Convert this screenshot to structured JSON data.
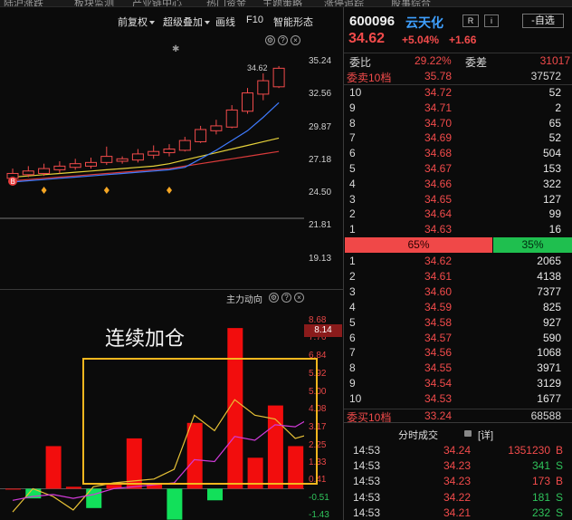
{
  "top_strip": [
    "陆沪涨跌",
    "板块监测",
    "产业链中心",
    "热门资金",
    "主题策略",
    "涨停追踪",
    "股事综合"
  ],
  "toolbar": {
    "fuquan": "前复权",
    "overlay": "超级叠加",
    "draw": "画线",
    "f10": "F10",
    "smart": "智能形态",
    "panel_icons": [
      "⚙",
      "?",
      "×"
    ]
  },
  "stock": {
    "code": "600096",
    "name": "云天化",
    "r_label": "R",
    "i_label": "i",
    "watchlist_btn": "-自选",
    "price": "34.62",
    "pct_change": "+5.04%",
    "change": "+1.66"
  },
  "weibi": {
    "label": "委比",
    "value": "29.22%",
    "diff_label": "委差",
    "diff_value": "31017"
  },
  "sell_header": {
    "label": "委卖10档",
    "avg_price": "35.78",
    "total": "37572"
  },
  "sell_levels": [
    {
      "level": "10",
      "price": "34.72",
      "volume": "52"
    },
    {
      "level": "9",
      "price": "34.71",
      "volume": "2"
    },
    {
      "level": "8",
      "price": "34.70",
      "volume": "65"
    },
    {
      "level": "7",
      "price": "34.69",
      "volume": "52"
    },
    {
      "level": "6",
      "price": "34.68",
      "volume": "504"
    },
    {
      "level": "5",
      "price": "34.67",
      "volume": "153"
    },
    {
      "level": "4",
      "price": "34.66",
      "volume": "322"
    },
    {
      "level": "3",
      "price": "34.65",
      "volume": "127"
    },
    {
      "level": "2",
      "price": "34.64",
      "volume": "99"
    },
    {
      "level": "1",
      "price": "34.63",
      "volume": "16"
    }
  ],
  "ratio": {
    "buy_pct": "65%",
    "sell_pct": "35%",
    "buy_fraction": 0.65
  },
  "buy_levels": [
    {
      "level": "1",
      "price": "34.62",
      "volume": "2065"
    },
    {
      "level": "2",
      "price": "34.61",
      "volume": "4138"
    },
    {
      "level": "3",
      "price": "34.60",
      "volume": "7377"
    },
    {
      "level": "4",
      "price": "34.59",
      "volume": "825"
    },
    {
      "level": "5",
      "price": "34.58",
      "volume": "927"
    },
    {
      "level": "6",
      "price": "34.57",
      "volume": "590"
    },
    {
      "level": "7",
      "price": "34.56",
      "volume": "1068"
    },
    {
      "level": "8",
      "price": "34.55",
      "volume": "3971"
    },
    {
      "level": "9",
      "price": "34.54",
      "volume": "3129"
    },
    {
      "level": "10",
      "price": "34.53",
      "volume": "1677"
    }
  ],
  "buy_header": {
    "label": "委买10档",
    "avg_price": "33.24",
    "total": "68588"
  },
  "trades_header": {
    "title": "分时成交",
    "detail": "[详]"
  },
  "trades": [
    {
      "time": "14:53",
      "price": "34.24",
      "volume": "1351230",
      "side": "B"
    },
    {
      "time": "14:53",
      "price": "34.23",
      "volume": "341",
      "side": "S"
    },
    {
      "time": "14:53",
      "price": "34.23",
      "volume": "173",
      "side": "B"
    },
    {
      "time": "14:53",
      "price": "34.22",
      "volume": "181",
      "side": "S"
    },
    {
      "time": "14:53",
      "price": "34.21",
      "volume": "232",
      "side": "S"
    }
  ],
  "price_axis": [
    "35.24",
    "32.56",
    "29.87",
    "27.18",
    "24.50",
    "21.81",
    "19.13"
  ],
  "price_max_label": "34.62",
  "marker_label": "B",
  "flow_panel": {
    "title": "主力动向",
    "current_value": "8.14",
    "axis": [
      "8.68",
      "7.76",
      "6.84",
      "5.92",
      "5.00",
      "4.08",
      "3.17",
      "2.25",
      "1.33",
      "0.41",
      "-0.51",
      "-1.43"
    ],
    "annotation": "连续加仓"
  },
  "colors": {
    "up": "#f24b4b",
    "down": "#1fbf4f",
    "accent": "#3fa0ff",
    "highlight": "#f5b71e"
  },
  "chart_data": [
    {
      "type": "candlestick",
      "title": "",
      "ylim": [
        19.13,
        35.24
      ],
      "candles": [
        {
          "open": 25.6,
          "close": 26.0,
          "high": 26.4,
          "low": 25.3
        },
        {
          "open": 25.9,
          "close": 26.2,
          "high": 26.6,
          "low": 25.7
        },
        {
          "open": 26.0,
          "close": 26.4,
          "high": 26.8,
          "low": 25.8
        },
        {
          "open": 26.3,
          "close": 26.6,
          "high": 27.0,
          "low": 26.0
        },
        {
          "open": 26.5,
          "close": 26.8,
          "high": 27.2,
          "low": 26.3
        },
        {
          "open": 26.6,
          "close": 26.9,
          "high": 27.3,
          "low": 26.4
        },
        {
          "open": 26.9,
          "close": 27.4,
          "high": 28.2,
          "low": 26.7
        },
        {
          "open": 27.0,
          "close": 27.2,
          "high": 27.4,
          "low": 26.8
        },
        {
          "open": 27.1,
          "close": 27.6,
          "high": 28.0,
          "low": 26.9
        },
        {
          "open": 27.5,
          "close": 27.8,
          "high": 28.3,
          "low": 27.2
        },
        {
          "open": 27.7,
          "close": 28.0,
          "high": 28.4,
          "low": 27.4
        },
        {
          "open": 27.9,
          "close": 28.7,
          "high": 29.0,
          "low": 27.8
        },
        {
          "open": 28.6,
          "close": 29.6,
          "high": 29.9,
          "low": 28.5
        },
        {
          "open": 29.5,
          "close": 29.9,
          "high": 30.4,
          "low": 29.2
        },
        {
          "open": 29.8,
          "close": 31.2,
          "high": 31.6,
          "low": 29.7
        },
        {
          "open": 31.1,
          "close": 32.6,
          "high": 33.0,
          "low": 30.9
        },
        {
          "open": 32.5,
          "close": 33.6,
          "high": 34.2,
          "low": 32.0
        },
        {
          "open": 33.1,
          "close": 34.62,
          "high": 34.8,
          "low": 33.0
        }
      ],
      "ma_blue": [
        25.3,
        25.4,
        25.5,
        25.6,
        25.7,
        25.8,
        25.9,
        26.0,
        26.1,
        26.2,
        26.3,
        26.5,
        27.2,
        27.9,
        28.7,
        29.5,
        30.6,
        31.8
      ],
      "ma_yellow": [
        25.7,
        25.8,
        25.9,
        26.0,
        26.1,
        26.2,
        26.3,
        26.4,
        26.5,
        26.6,
        26.8,
        27.1,
        27.4,
        27.7,
        28.0,
        28.3,
        28.6,
        28.9
      ],
      "ma_red": [
        25.4,
        25.5,
        25.6,
        25.7,
        25.8,
        25.9,
        26.0,
        26.1,
        26.2,
        26.3,
        26.4,
        26.6,
        26.8,
        27.0,
        27.2,
        27.4,
        27.6,
        27.8
      ],
      "diamond_indices": [
        2,
        6,
        10
      ]
    },
    {
      "type": "bar",
      "title": "主力动向",
      "ylim": [
        -1.43,
        8.68
      ],
      "values": [
        0.0,
        -0.5,
        2.2,
        0.1,
        -1.0,
        0.2,
        2.6,
        0.3,
        -1.6,
        3.4,
        -0.6,
        8.3,
        1.6,
        4.3,
        2.2,
        2.2
      ],
      "line_a": [
        -1.2,
        0.0,
        -0.4,
        -1.1,
        0.1,
        0.3,
        0.4,
        0.5,
        1.0,
        3.8,
        3.0,
        4.6,
        3.8,
        3.6,
        2.6,
        2.9
      ],
      "line_b": [
        -0.6,
        -0.4,
        -0.3,
        -0.5,
        -0.3,
        0.0,
        0.1,
        0.2,
        0.3,
        1.5,
        1.4,
        2.7,
        2.5,
        3.3,
        3.2,
        3.8
      ]
    }
  ]
}
